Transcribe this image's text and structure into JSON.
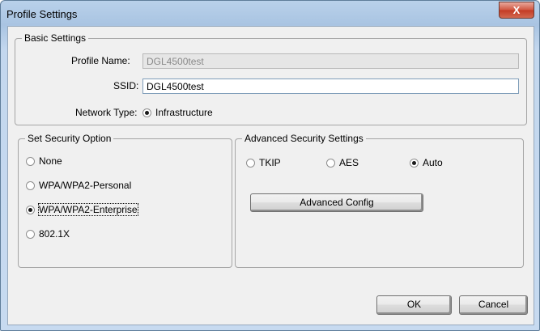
{
  "window": {
    "title": "Profile Settings",
    "close_label": "X"
  },
  "basic_settings": {
    "legend": "Basic Settings",
    "profile_name_label": "Profile Name:",
    "profile_name_value": "DGL4500test",
    "ssid_label": "SSID:",
    "ssid_value": "DGL4500test",
    "network_type_label": "Network Type:",
    "network_type_value": "Infrastructure"
  },
  "security_option": {
    "legend": "Set Security Option",
    "options": [
      {
        "label": "None",
        "selected": false
      },
      {
        "label": "WPA/WPA2-Personal",
        "selected": false
      },
      {
        "label": "WPA/WPA2-Enterprise",
        "selected": true
      },
      {
        "label": "802.1X",
        "selected": false
      }
    ]
  },
  "advanced_security": {
    "legend": "Advanced Security Settings",
    "options": [
      {
        "label": "TKIP",
        "selected": false
      },
      {
        "label": "AES",
        "selected": false
      },
      {
        "label": "Auto",
        "selected": true
      }
    ],
    "config_button": "Advanced Config"
  },
  "buttons": {
    "ok": "OK",
    "cancel": "Cancel"
  }
}
